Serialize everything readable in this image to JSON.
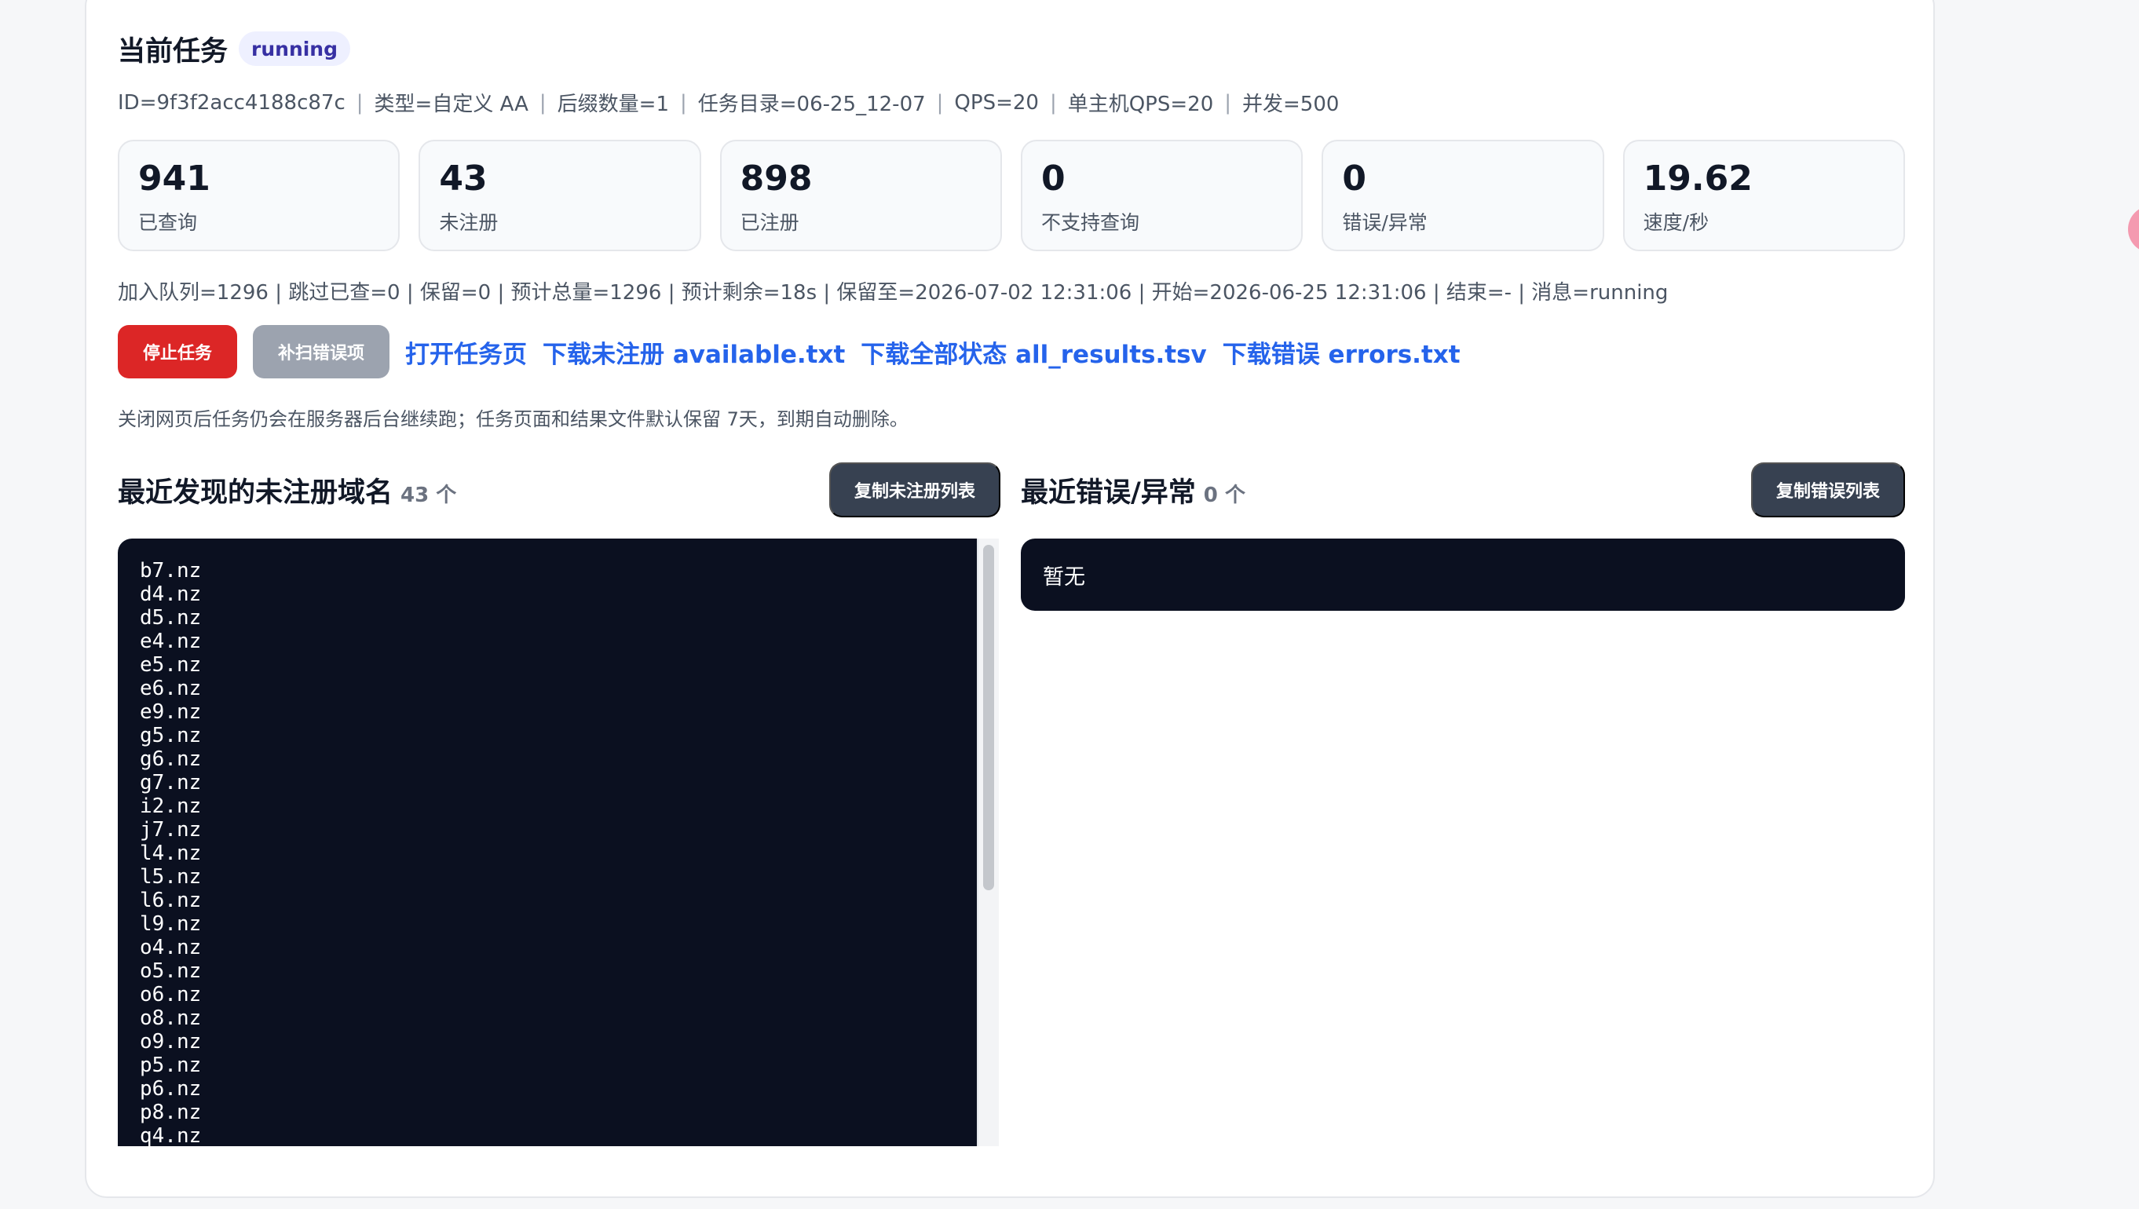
{
  "header": {
    "title": "当前任务",
    "status": "running"
  },
  "meta": [
    "ID=9f3f2acc4188c87c",
    "类型=自定义 AA",
    "后缀数量=1",
    "任务目录=06-25_12-07",
    "QPS=20",
    "单主机QPS=20",
    "并发=500"
  ],
  "stats": [
    {
      "value": "941",
      "label": "已查询"
    },
    {
      "value": "43",
      "label": "未注册"
    },
    {
      "value": "898",
      "label": "已注册"
    },
    {
      "value": "0",
      "label": "不支持查询"
    },
    {
      "value": "0",
      "label": "错误/异常"
    },
    {
      "value": "19.62",
      "label": "速度/秒"
    }
  ],
  "summary": "加入队列=1296 | 跳过已查=0 | 保留=0 | 预计总量=1296 | 预计剩余=18s | 保留至=2026-07-02 12:31:06 | 开始=2026-06-25 12:31:06 | 结束=- | 消息=running",
  "actions": {
    "stop": "停止任务",
    "rescan": "补扫错误项",
    "open": "打开任务页",
    "download_available": "下载未注册 available.txt",
    "download_all": "下载全部状态 all_results.tsv",
    "download_errors": "下载错误 errors.txt"
  },
  "note": "关闭网页后任务仍会在服务器后台继续跑；任务页面和结果文件默认保留 7天，到期自动删除。",
  "available_panel": {
    "title": "最近发现的未注册域名",
    "count": "43 个",
    "copy_button": "复制未注册列表",
    "domains": [
      "b7.nz",
      "d4.nz",
      "d5.nz",
      "e4.nz",
      "e5.nz",
      "e6.nz",
      "e9.nz",
      "g5.nz",
      "g6.nz",
      "g7.nz",
      "i2.nz",
      "j7.nz",
      "l4.nz",
      "l5.nz",
      "l6.nz",
      "l9.nz",
      "o4.nz",
      "o5.nz",
      "o6.nz",
      "o8.nz",
      "o9.nz",
      "p5.nz",
      "p6.nz",
      "p8.nz",
      "q4.nz"
    ]
  },
  "error_panel": {
    "title": "最近错误/异常",
    "count": "0 个",
    "copy_button": "复制错误列表",
    "empty": "暂无"
  }
}
